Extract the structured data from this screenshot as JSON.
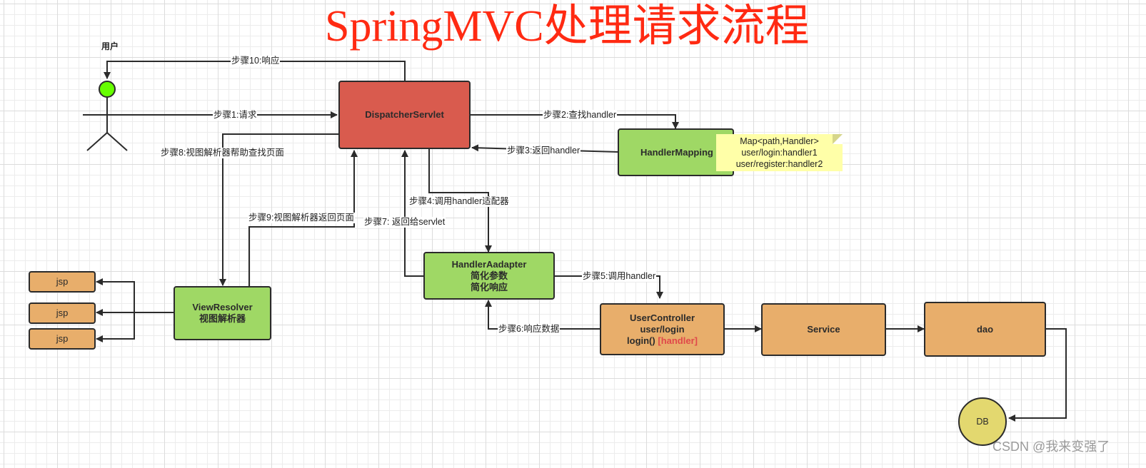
{
  "title": "SpringMVC处理请求流程",
  "actor": {
    "label": "用户"
  },
  "nodes": {
    "dispatcher": "DispatcherServlet",
    "handler_mapping": "HandlerMapping",
    "handler_adapter": {
      "line1": "HandlerAadapter",
      "line2": "简化参数",
      "line3": "简化响应"
    },
    "view_resolver": {
      "line1": "ViewResolver",
      "line2": "视图解析器"
    },
    "user_controller": {
      "line1": "UserController",
      "line2": "user/login",
      "line3": "login()",
      "tag": "[handler]"
    },
    "service": "Service",
    "dao": "dao",
    "db": "DB",
    "jsp": [
      "jsp",
      "jsp",
      "jsp"
    ]
  },
  "note": {
    "lines": [
      "Map<path,Handler>",
      "user/login:handler1",
      "user/register:handler2"
    ]
  },
  "steps": {
    "s1": "步骤1:请求",
    "s2": "步骤2:查找handler",
    "s3": "步骤3:返回handler",
    "s4": "步骤4:调用handler适配器",
    "s5": "步骤5:调用handler",
    "s6": "步骤6:响应数据",
    "s7": "步骤7: 返回给servlet",
    "s8": "步骤8:视图解析器帮助查找页面",
    "s9": "步骤9:视图解析器返回页面",
    "s10": "步骤10:响应"
  },
  "colors": {
    "title": "#ff2a12",
    "dispatcher": "#d95b4e",
    "green_nodes": "#9fd865",
    "orange_nodes": "#e8ae6b",
    "db": "#e3d86f",
    "note": "#ffffa8",
    "actor_head": "#66ff00",
    "handler_tag": "#e0484a"
  },
  "watermark": "CSDN @我来变强了"
}
